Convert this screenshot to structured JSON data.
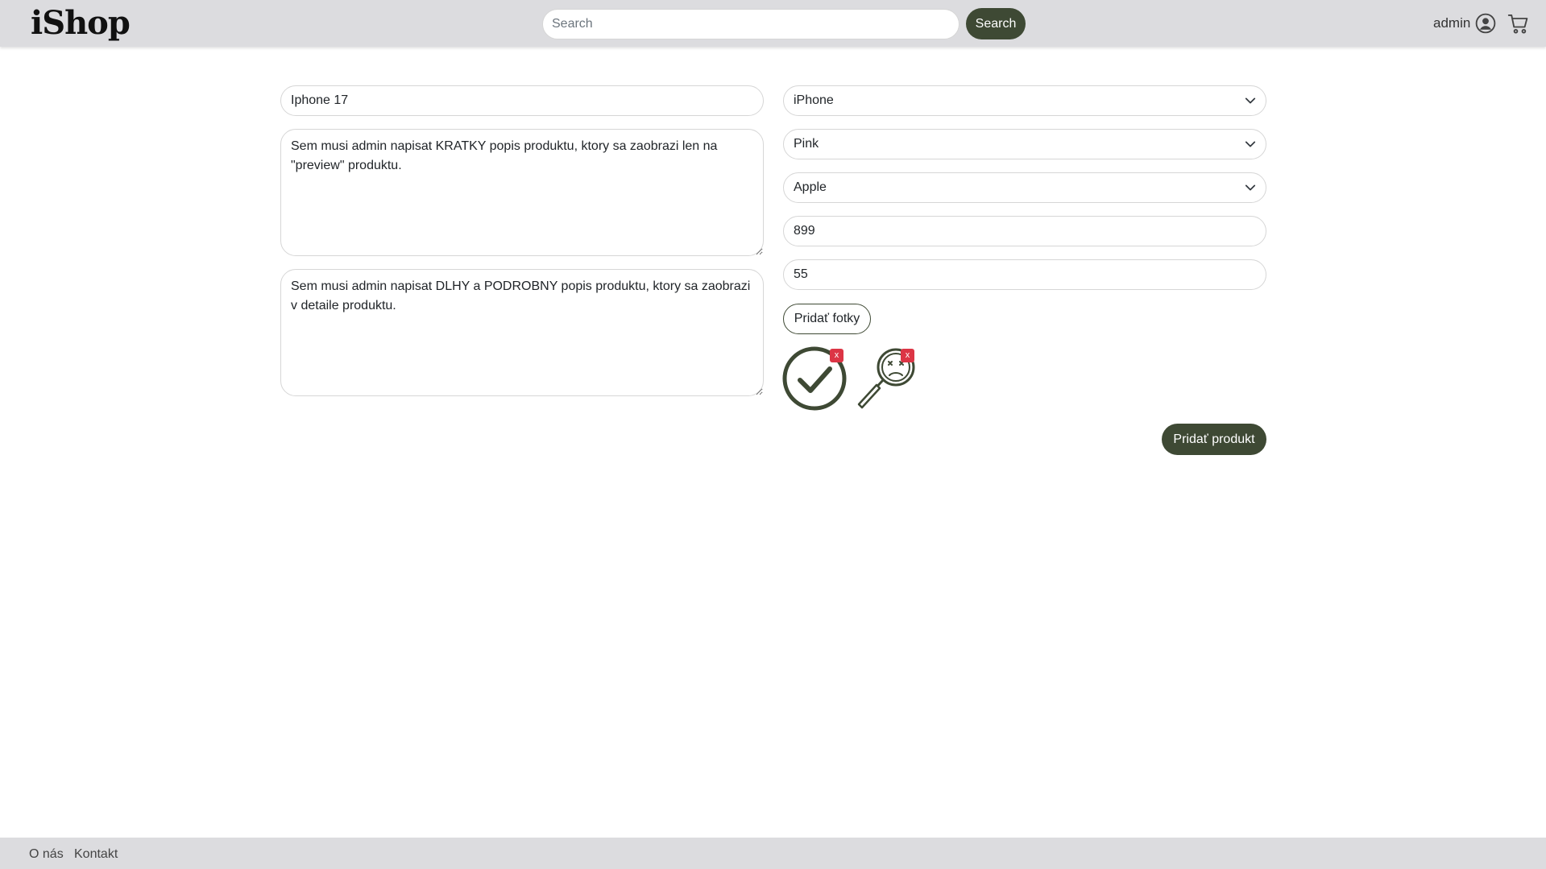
{
  "header": {
    "logo": "iShop",
    "search_placeholder": "Search",
    "search_button": "Search",
    "user_label": "admin",
    "icons": [
      "user-circle-icon",
      "cart-icon"
    ]
  },
  "form": {
    "product_name": "Iphone 17",
    "short_description": "Sem musi admin napisat KRATKY popis produktu, ktory sa zaobrazi len na \"preview\" produktu.",
    "long_description": "Sem musi admin napisat DLHY a PODROBNY popis produktu, ktory sa zaobrazi v detaile produktu.",
    "category": "iPhone",
    "color": "Pink",
    "brand": "Apple",
    "price": "899",
    "quantity": "55",
    "add_photos_label": "Pridať fotky",
    "photos": [
      {
        "icon": "checkmark-circle-icon",
        "remove_label": "x"
      },
      {
        "icon": "sad-magnifier-icon",
        "remove_label": "x"
      }
    ],
    "submit_label": "Pridať produkt"
  },
  "footer": {
    "links": [
      "O nás",
      "Kontakt"
    ]
  },
  "colors": {
    "accent": "#3e4934",
    "danger": "#dc3545",
    "bar": "#dcdcdf"
  }
}
